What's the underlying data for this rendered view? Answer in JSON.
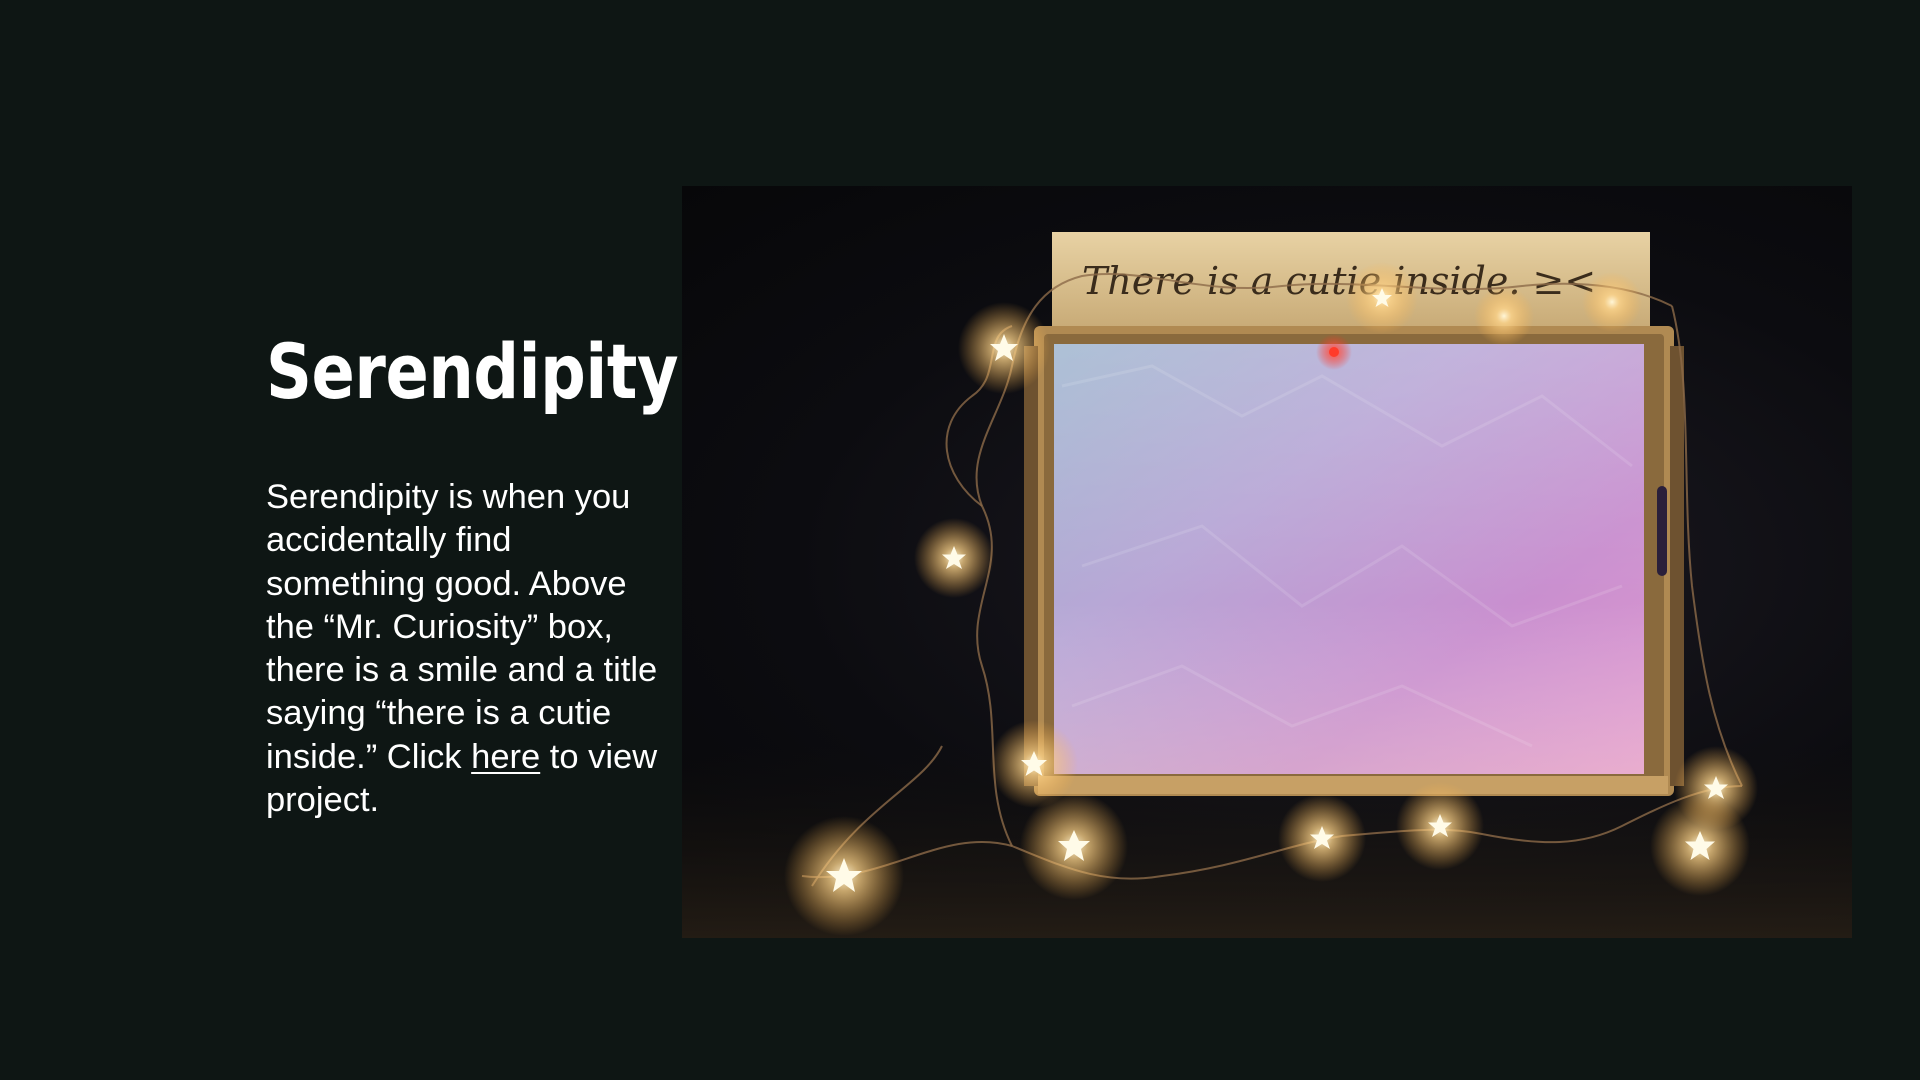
{
  "slide": {
    "title": "Serendipity  Box",
    "description": {
      "before_link": "Serendipity is when you accidentally find something good. Above the “Mr. Curiosity” box, there is a smile and a title saying “there is a cutie inside.” Click ",
      "link_text": "here",
      "after_link": " to view project."
    }
  },
  "photo": {
    "subject": "box-with-fairy-lights",
    "sign_text": "There is a cutie inside. ≥<"
  },
  "colors": {
    "background": "#0e1614",
    "text": "#ffffff",
    "light_glow": "#ffd58a"
  }
}
